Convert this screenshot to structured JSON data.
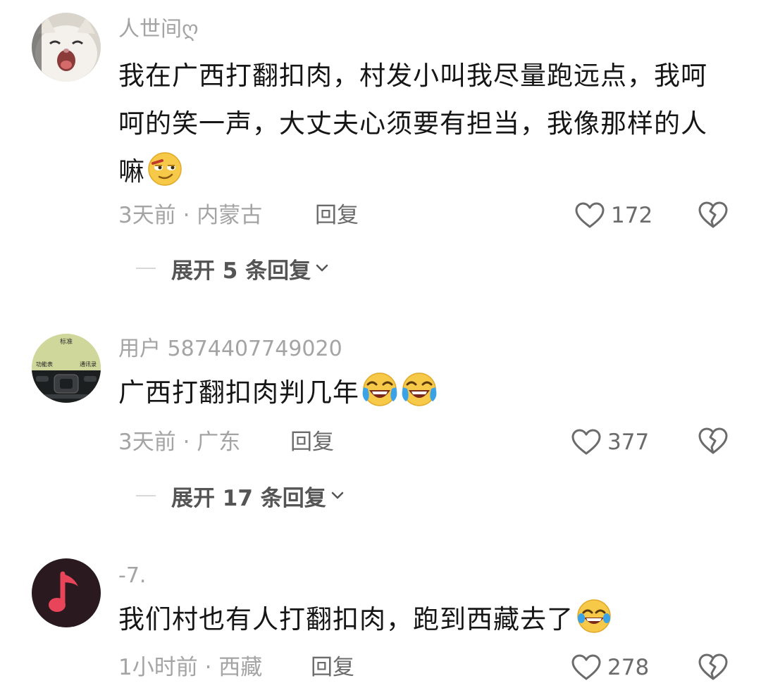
{
  "comments": [
    {
      "username": "人世间ღ",
      "avatar": "cat-avatar",
      "text": "我在广西打翻扣肉，村发小叫我尽量跑远点，我呵呵的笑一声，大丈夫心须要有担当，我像那样的人嘛",
      "emojis": [
        "smirk-emoji"
      ],
      "time_location": "3天前 · 内蒙古",
      "reply_label": "回复",
      "likes": "172",
      "expand_label": "展开 5 条回复"
    },
    {
      "username": "用户 5874407749020",
      "avatar": "phone-avatar",
      "text": "广西打翻扣肉判几年",
      "emojis": [
        "crying-laughing-emoji",
        "crying-laughing-emoji"
      ],
      "time_location": "3天前 · 广东",
      "reply_label": "回复",
      "likes": "377",
      "expand_label": "展开 17 条回复"
    },
    {
      "username": "-7.",
      "avatar": "music-note-avatar",
      "text": "我们村也有人打翻扣肉，跑到西藏去了",
      "emojis": [
        "laughing-tears-emoji"
      ],
      "time_location": "1小时前 · 西藏",
      "reply_label": "回复",
      "likes": "278"
    }
  ],
  "avatar_phone_labels": [
    "标准",
    "功能表",
    "通讯录"
  ],
  "colors": {
    "muted_text": "#a4a4a4",
    "body_text": "#161616",
    "music_avatar_bg": "#2a1a1f",
    "music_note": "#e8445a"
  }
}
